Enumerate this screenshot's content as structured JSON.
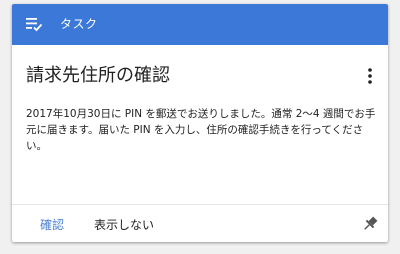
{
  "header": {
    "title": "タスク",
    "icon": "task-list-check-icon",
    "color": "#3c78d8"
  },
  "card": {
    "title": "請求先住所の確認",
    "body": "2017年10月30日に PIN を郵送でお送りしました。通常 2～4 週間でお手元に届きます。届いた PIN を入力し、住所の確認手続きを行ってください。",
    "menu_icon": "more-vert-icon"
  },
  "actions": {
    "confirm_label": "確認",
    "hide_label": "表示しない",
    "pin_icon": "pin-icon",
    "accent_color": "#4a7fd3"
  }
}
